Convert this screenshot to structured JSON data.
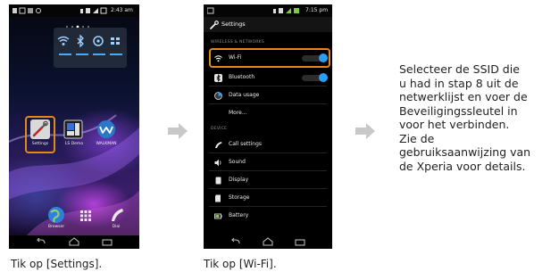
{
  "phone1": {
    "status": {
      "time": "2:43 am"
    },
    "apps": {
      "settings": "Settings",
      "lsdemo": "LS Demo",
      "walkman": "WALKMAN"
    },
    "dock": {
      "browser": "Browser",
      "dial": "Dial"
    }
  },
  "phone2": {
    "status": {
      "time": "7:15 pm"
    },
    "title": "Settings",
    "sections": {
      "wireless": "WIRELESS & NETWORKS",
      "device": "DEVICE"
    },
    "items": {
      "wifi": "Wi-Fi",
      "bluetooth": "Bluetooth",
      "data_usage": "Data usage",
      "more": "More...",
      "call_settings": "Call settings",
      "sound": "Sound",
      "display": "Display",
      "storage": "Storage",
      "battery": "Battery"
    }
  },
  "captions": {
    "step1": "Tik op [Settings].",
    "step2": "Tik op [Wi-Fi]."
  },
  "instructions": [
    "Selecteer de SSID die",
    "u had in stap 8 uit de",
    "netwerklijst en voer de",
    "Beveiligingssleutel in",
    "voor het verbinden.",
    "Zie de",
    "gebruiksaanwijzing van",
    "de Xperia voor details."
  ],
  "colors": {
    "highlight": "#e08a1e",
    "toggle_on": "#2a9df4",
    "arrow": "#c8c8c8"
  }
}
